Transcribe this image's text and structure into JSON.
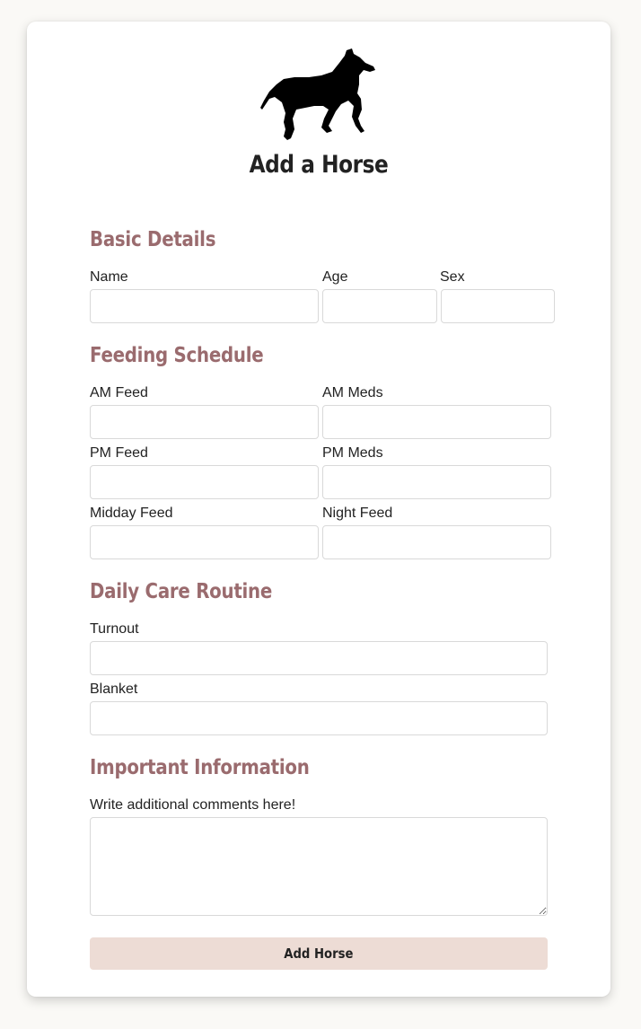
{
  "page": {
    "title": "Add a Horse",
    "accent_color": "#9a6b6e",
    "button_color": "#eddcd5"
  },
  "logo": {
    "icon": "horse-silhouette-icon"
  },
  "basic": {
    "heading": "Basic Details",
    "name_label": "Name",
    "name_value": "",
    "age_label": "Age",
    "age_value": "",
    "sex_label": "Sex",
    "sex_value": ""
  },
  "feeding": {
    "heading": "Feeding Schedule",
    "am_feed_label": "AM Feed",
    "am_meds_label": "AM Meds",
    "pm_feed_label": "PM Feed",
    "pm_meds_label": "PM Meds",
    "midday_feed_label": "Midday Feed",
    "night_feed_label": "Night Feed"
  },
  "care": {
    "heading": "Daily Care Routine",
    "turnout_label": "Turnout",
    "blanket_label": "Blanket"
  },
  "important": {
    "heading": "Important Information",
    "comments_label": "Write additional comments here!"
  },
  "submit": {
    "label": "Add Horse"
  }
}
